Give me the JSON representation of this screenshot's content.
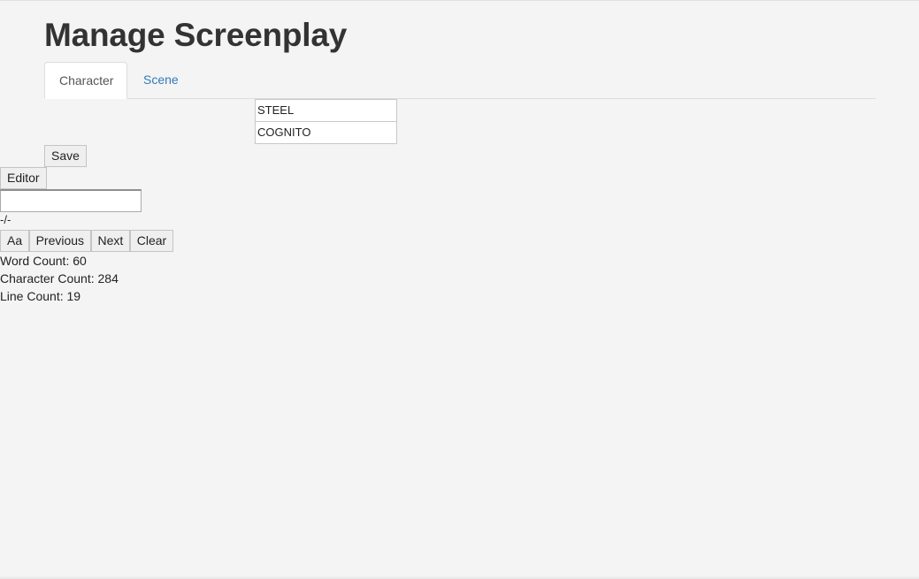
{
  "page": {
    "title": "Manage Screenplay"
  },
  "tabs": [
    {
      "label": "Character",
      "active": true
    },
    {
      "label": "Scene",
      "active": false
    }
  ],
  "characters": [
    "STEEL",
    "COGNITO"
  ],
  "actions": {
    "save_label": "Save"
  },
  "editor": {
    "toggle_label": "Editor",
    "search_value": "",
    "match_counter": "-/-",
    "buttons": {
      "case_label": "Aa",
      "previous_label": "Previous",
      "next_label": "Next",
      "clear_label": "Clear"
    }
  },
  "stats": {
    "word_count": "Word Count: 60",
    "character_count": "Character Count: 284",
    "line_count": "Line Count: 19"
  },
  "colors": {
    "background": "#f4f4f4",
    "link": "#337ab7",
    "text": "#333333"
  }
}
